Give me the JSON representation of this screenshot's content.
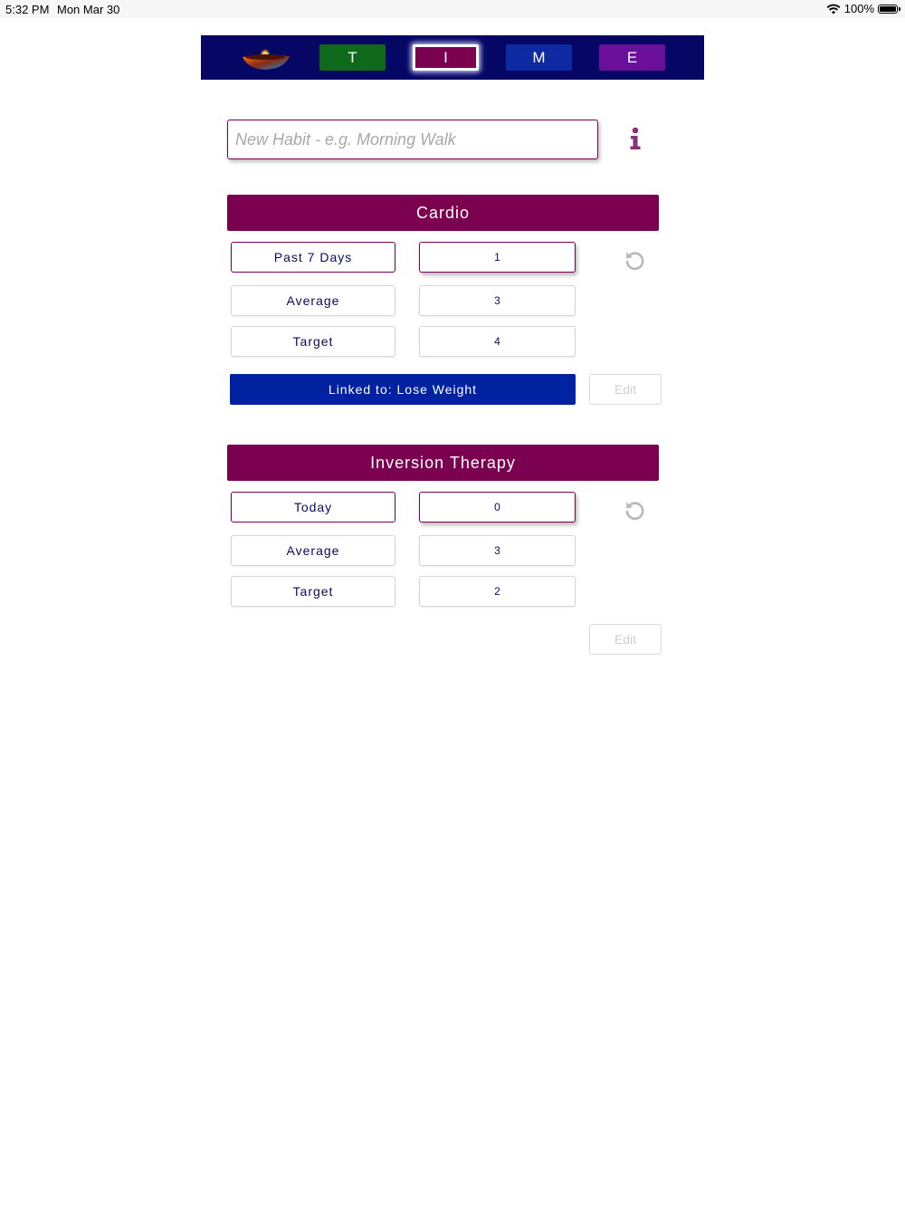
{
  "status": {
    "time": "5:32 PM",
    "date": "Mon Mar 30",
    "battery": "100%"
  },
  "nav": {
    "t_label": "T",
    "i_label": "I",
    "m_label": "M",
    "e_label": "E",
    "selected": "I",
    "colors": {
      "bar": "#060765",
      "t": "#0e6a1a",
      "i": "#7b0050",
      "m": "#0d2aa3",
      "e": "#6a0f99"
    }
  },
  "new_habit": {
    "placeholder": "New Habit - e.g. Morning Walk",
    "value": ""
  },
  "habits": [
    {
      "name": "Cardio",
      "period_label": "Past 7 Days",
      "period_value": "1",
      "average_label": "Average",
      "average_value": "3",
      "target_label": "Target",
      "target_value": "4",
      "linked_label": "Linked to: Lose Weight",
      "edit_label": "Edit"
    },
    {
      "name": "Inversion Therapy",
      "period_label": "Today",
      "period_value": "0",
      "average_label": "Average",
      "average_value": "3",
      "target_label": "Target",
      "target_value": "2",
      "edit_label": "Edit"
    }
  ],
  "icons": {
    "logo": "oil-lamp-icon",
    "info": "info-icon",
    "reset": "reset-icon",
    "wifi": "wifi-icon",
    "battery": "battery-icon"
  }
}
